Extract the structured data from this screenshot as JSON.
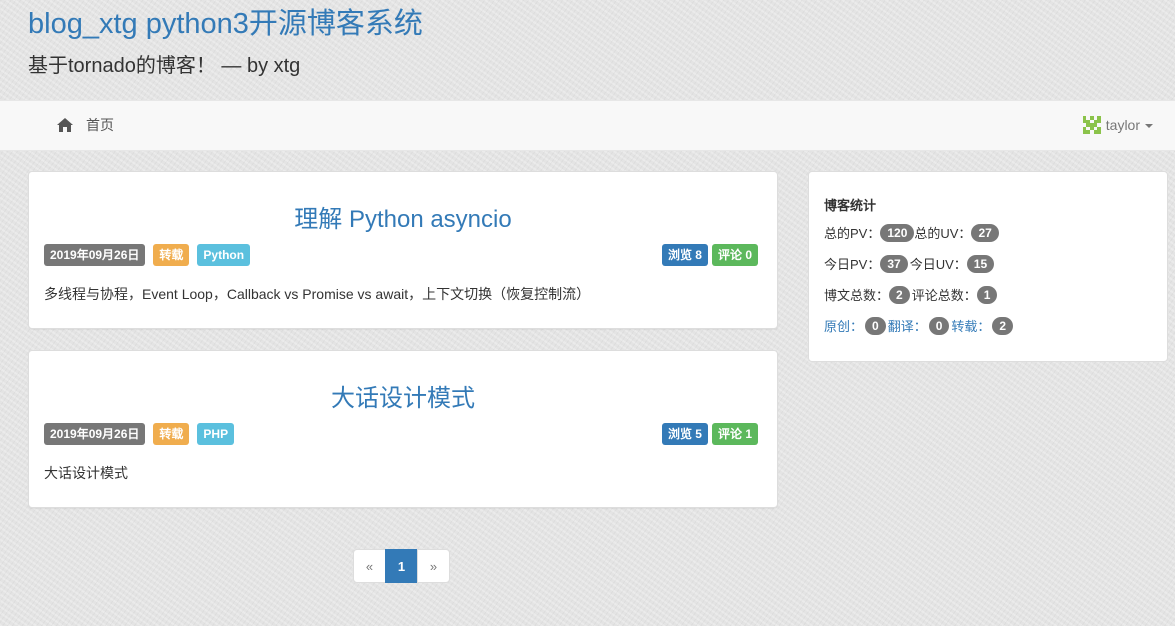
{
  "header": {
    "title": "blog_xtg python3开源博客系统",
    "subtitle": "基于tornado的博客！ — by xtg"
  },
  "navbar": {
    "home_label": "首页",
    "home_icon": "home-icon",
    "user_name": "taylor",
    "user_icon": "avatar-identicon"
  },
  "posts": [
    {
      "title": "理解 Python asyncio",
      "date": "2019年09月26日",
      "type": "转载",
      "category": "Python",
      "views": "浏览 8",
      "comments": "评论 0",
      "excerpt": "多线程与协程，Event Loop，Callback vs Promise vs await，上下文切换（恢复控制流）"
    },
    {
      "title": "大话设计模式",
      "date": "2019年09月26日",
      "type": "转载",
      "category": "PHP",
      "views": "浏览 5",
      "comments": "评论 1",
      "excerpt": "大话设计模式"
    }
  ],
  "stats": {
    "title": "博客统计",
    "total_pv_label": "总的PV：",
    "total_pv": "120",
    "total_uv_label": "总的UV：",
    "total_uv": "27",
    "today_pv_label": "今日PV：",
    "today_pv": "37",
    "today_uv_label": "今日UV：",
    "today_uv": "15",
    "posts_label": "博文总数：",
    "posts": "2",
    "comments_label": "评论总数：",
    "comments": "1",
    "original_label": "原创：",
    "original": "0",
    "translated_label": "翻译：",
    "translated": "0",
    "reprinted_label": "转载：",
    "reprinted": "2"
  },
  "pagination": {
    "prev": "«",
    "current": "1",
    "next": "»"
  },
  "colors": {
    "link": "#337ab7",
    "label_default": "#777777",
    "label_warning": "#f0ad4e",
    "label_info": "#5bc0de",
    "label_success": "#5cb85c"
  }
}
